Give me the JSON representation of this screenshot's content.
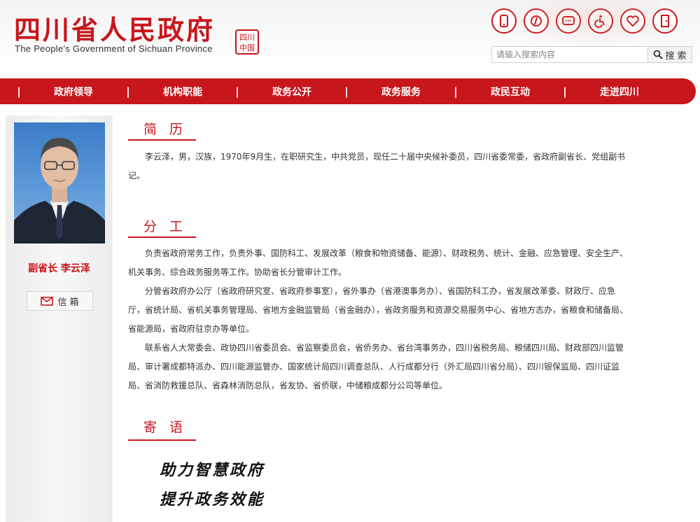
{
  "header": {
    "title": "四川省人民政府",
    "subtitle": "The People's Government of Sichuan Province",
    "seal_text": "四川 中国",
    "icons": [
      "mobile-icon",
      "weibo-icon",
      "wechat-icon",
      "accessibility-icon",
      "elderly-care-icon",
      "exit-door-icon"
    ],
    "accent_color": "#c8161d"
  },
  "search": {
    "placeholder": "请输入搜索内容",
    "button_label": "搜 索"
  },
  "nav": {
    "items": [
      "政府领导",
      "机构职能",
      "政务公开",
      "政务服务",
      "政民互动",
      "走进四川"
    ]
  },
  "sidebar": {
    "name_label": "副省长 李云泽",
    "mailbox_label": "信 箱"
  },
  "sections": {
    "resume": {
      "title": "简 历",
      "text": "李云泽，男，汉族，1970年9月生，在职研究生，中共党员，现任二十届中央候补委员，四川省委常委，省政府副省长、党组副书记。"
    },
    "duties": {
      "title": "分 工",
      "paragraphs": [
        "负责省政府常务工作，负责外事、国防科工、发展改革（粮食和物资储备、能源）、财政税务、统计、金融、应急管理、安全生产、机关事务、综合政务服务等工作。协助省长分管审计工作。",
        "分管省政府办公厅（省政府研究室、省政府参事室），省外事办（省港澳事务办）、省国防科工办，省发展改革委、财政厅、应急厅，省统计局、省机关事务管理局、省地方金融监管局（省金融办），省政务服务和资源交易服务中心、省地方志办，省粮食和储备局、省能源局，省政府驻京办等单位。",
        "联系省人大常委会、政协四川省委员会、省监察委员会，省侨务办、省台湾事务办，四川省税务局、粮储四川局、财政部四川监管局、审计署成都特派办、四川能源监管办、国家统计局四川调查总队、人行成都分行（外汇局四川省分局）、四川银保监局、四川证监局、省消防救援总队、省森林消防总队，省友协、省侨联，中储粮成都分公司等单位。"
      ]
    },
    "message": {
      "title": "寄 语",
      "lines": [
        "助力智慧政府",
        "提升政务效能"
      ]
    }
  }
}
